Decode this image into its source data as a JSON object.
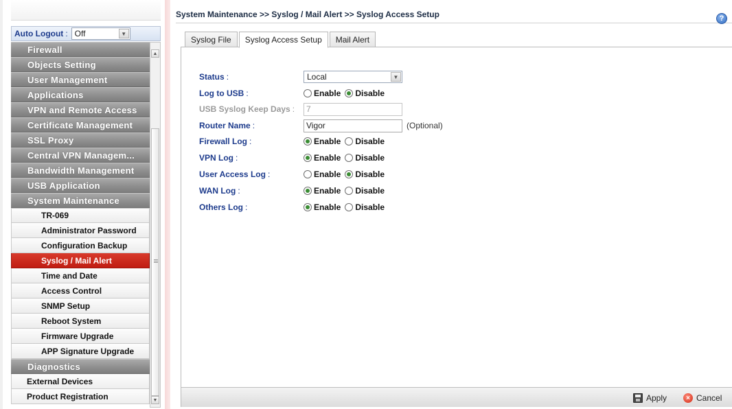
{
  "breadcrumb": "System Maintenance >> Syslog / Mail Alert >> Syslog Access Setup",
  "help_glyph": "?",
  "sidebar": {
    "auto_logout_label": "Auto Logout",
    "auto_logout_colon": ":",
    "auto_logout_value": "Off",
    "categories_top": [
      "Firewall",
      "Objects Setting",
      "User Management",
      "Applications",
      "VPN and Remote Access",
      "Certificate Management",
      "SSL Proxy",
      "Central VPN Managem...",
      "Bandwidth Management",
      "USB Application",
      "System Maintenance"
    ],
    "system_maintenance_items": [
      "TR-069",
      "Administrator Password",
      "Configuration Backup",
      "Syslog / Mail Alert",
      "Time and Date",
      "Access Control",
      "SNMP Setup",
      "Reboot System",
      "Firmware Upgrade",
      "APP Signature Upgrade"
    ],
    "active_item": "Syslog / Mail Alert",
    "diagnostics": "Diagnostics",
    "external_devices": "External Devices",
    "product_registration": "Product Registration"
  },
  "tabs": [
    {
      "label": "Syslog File",
      "active": false
    },
    {
      "label": "Syslog Access Setup",
      "active": true
    },
    {
      "label": "Mail Alert",
      "active": false
    }
  ],
  "form": {
    "colon": ":",
    "status": {
      "label": "Status",
      "value": "Local"
    },
    "log_to_usb": {
      "label": "Log to USB",
      "enable": "Enable",
      "disable": "Disable",
      "selected": "Disable"
    },
    "usb_keep_days": {
      "label": "USB Syslog Keep Days",
      "value": "7"
    },
    "router_name": {
      "label": "Router Name",
      "value": "Vigor",
      "hint": "(Optional)"
    },
    "firewall_log": {
      "label": "Firewall Log",
      "enable": "Enable",
      "disable": "Disable",
      "selected": "Enable"
    },
    "vpn_log": {
      "label": "VPN Log",
      "enable": "Enable",
      "disable": "Disable",
      "selected": "Enable"
    },
    "user_access_log": {
      "label": "User Access Log",
      "enable": "Enable",
      "disable": "Disable",
      "selected": "Disable"
    },
    "wan_log": {
      "label": "WAN Log",
      "enable": "Enable",
      "disable": "Disable",
      "selected": "Enable"
    },
    "others_log": {
      "label": "Others Log",
      "enable": "Enable",
      "disable": "Disable",
      "selected": "Enable"
    }
  },
  "footer": {
    "apply_label": "Apply",
    "cancel_label": "Cancel",
    "cancel_glyph": "×"
  },
  "colors": {
    "active_menu_red": "#c8251a",
    "label_blue": "#1d3b8c",
    "category_gray": "#8f8f8f",
    "radio_green": "#3a8c33"
  },
  "icons": [
    "help-icon",
    "save-icon",
    "cancel-icon",
    "chevron-down-icon"
  ]
}
